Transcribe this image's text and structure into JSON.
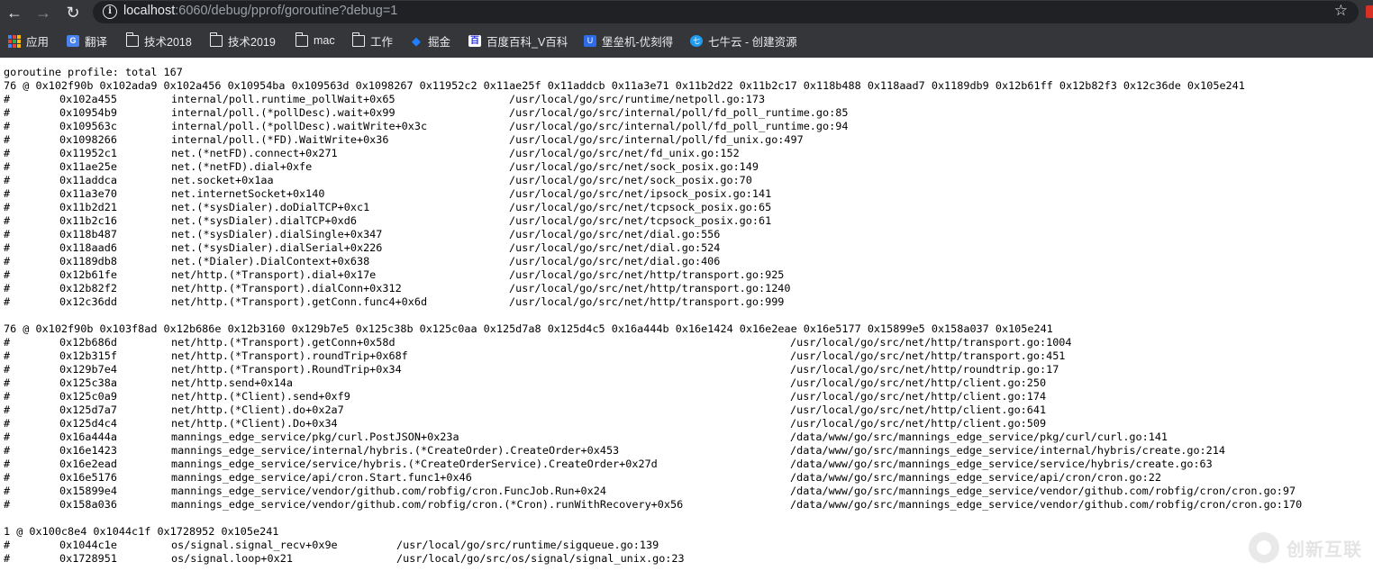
{
  "browser": {
    "url_host": "localhost",
    "url_rest": ":6060/debug/pprof/goroutine?debug=1",
    "nav_icons": [
      "back-arrow-icon",
      "forward-arrow-icon",
      "reload-icon",
      "info-icon",
      "star-icon"
    ],
    "bookmarks": [
      {
        "label": "应用",
        "icon": "apps-grid-icon"
      },
      {
        "label": "翻译",
        "icon": "google-translate-icon"
      },
      {
        "label": "技术2018",
        "icon": "folder-icon"
      },
      {
        "label": "技术2019",
        "icon": "folder-icon"
      },
      {
        "label": "mac",
        "icon": "folder-icon"
      },
      {
        "label": "工作",
        "icon": "folder-icon"
      },
      {
        "label": "掘金",
        "icon": "juejin-icon"
      },
      {
        "label": "百度百科_V百科",
        "icon": "baidu-icon"
      },
      {
        "label": "堡垒机-优刻得",
        "icon": "ucloud-icon"
      },
      {
        "label": "七牛云 - 创建资源",
        "icon": "qiniu-icon"
      }
    ]
  },
  "profile": {
    "header": "goroutine profile: total 167",
    "groups": [
      {
        "summary": "76 @ 0x102f90b 0x102ada9 0x102a456 0x10954ba 0x109563d 0x1098267 0x11952c2 0x11ae25f 0x11addcb 0x11a3e71 0x11b2d22 0x11b2c17 0x118b488 0x118aad7 0x1189db9 0x12b61ff 0x12b82f3 0x12c36de 0x105e241",
        "frames": [
          {
            "addr": "0x102a455",
            "func": "internal/poll.runtime_pollWait+0x65",
            "file": "/usr/local/go/src/runtime/netpoll.go:173"
          },
          {
            "addr": "0x10954b9",
            "func": "internal/poll.(*pollDesc).wait+0x99",
            "file": "/usr/local/go/src/internal/poll/fd_poll_runtime.go:85"
          },
          {
            "addr": "0x109563c",
            "func": "internal/poll.(*pollDesc).waitWrite+0x3c",
            "file": "/usr/local/go/src/internal/poll/fd_poll_runtime.go:94"
          },
          {
            "addr": "0x1098266",
            "func": "internal/poll.(*FD).WaitWrite+0x36",
            "file": "/usr/local/go/src/internal/poll/fd_unix.go:497"
          },
          {
            "addr": "0x11952c1",
            "func": "net.(*netFD).connect+0x271",
            "file": "/usr/local/go/src/net/fd_unix.go:152"
          },
          {
            "addr": "0x11ae25e",
            "func": "net.(*netFD).dial+0xfe",
            "file": "/usr/local/go/src/net/sock_posix.go:149"
          },
          {
            "addr": "0x11addca",
            "func": "net.socket+0x1aa",
            "file": "/usr/local/go/src/net/sock_posix.go:70"
          },
          {
            "addr": "0x11a3e70",
            "func": "net.internetSocket+0x140",
            "file": "/usr/local/go/src/net/ipsock_posix.go:141"
          },
          {
            "addr": "0x11b2d21",
            "func": "net.(*sysDialer).doDialTCP+0xc1",
            "file": "/usr/local/go/src/net/tcpsock_posix.go:65"
          },
          {
            "addr": "0x11b2c16",
            "func": "net.(*sysDialer).dialTCP+0xd6",
            "file": "/usr/local/go/src/net/tcpsock_posix.go:61"
          },
          {
            "addr": "0x118b487",
            "func": "net.(*sysDialer).dialSingle+0x347",
            "file": "/usr/local/go/src/net/dial.go:556"
          },
          {
            "addr": "0x118aad6",
            "func": "net.(*sysDialer).dialSerial+0x226",
            "file": "/usr/local/go/src/net/dial.go:524"
          },
          {
            "addr": "0x1189db8",
            "func": "net.(*Dialer).DialContext+0x638",
            "file": "/usr/local/go/src/net/dial.go:406"
          },
          {
            "addr": "0x12b61fe",
            "func": "net/http.(*Transport).dial+0x17e",
            "file": "/usr/local/go/src/net/http/transport.go:925"
          },
          {
            "addr": "0x12b82f2",
            "func": "net/http.(*Transport).dialConn+0x312",
            "file": "/usr/local/go/src/net/http/transport.go:1240"
          },
          {
            "addr": "0x12c36dd",
            "func": "net/http.(*Transport).getConn.func4+0x6d",
            "file": "/usr/local/go/src/net/http/transport.go:999"
          }
        ]
      },
      {
        "summary": "76 @ 0x102f90b 0x103f8ad 0x12b686e 0x12b3160 0x129b7e5 0x125c38b 0x125c0aa 0x125d7a8 0x125d4c5 0x16a444b 0x16e1424 0x16e2eae 0x16e5177 0x15899e5 0x158a037 0x105e241",
        "frames": [
          {
            "addr": "0x12b686d",
            "func": "net/http.(*Transport).getConn+0x58d",
            "file": "/usr/local/go/src/net/http/transport.go:1004"
          },
          {
            "addr": "0x12b315f",
            "func": "net/http.(*Transport).roundTrip+0x68f",
            "file": "/usr/local/go/src/net/http/transport.go:451"
          },
          {
            "addr": "0x129b7e4",
            "func": "net/http.(*Transport).RoundTrip+0x34",
            "file": "/usr/local/go/src/net/http/roundtrip.go:17"
          },
          {
            "addr": "0x125c38a",
            "func": "net/http.send+0x14a",
            "file": "/usr/local/go/src/net/http/client.go:250"
          },
          {
            "addr": "0x125c0a9",
            "func": "net/http.(*Client).send+0xf9",
            "file": "/usr/local/go/src/net/http/client.go:174"
          },
          {
            "addr": "0x125d7a7",
            "func": "net/http.(*Client).do+0x2a7",
            "file": "/usr/local/go/src/net/http/client.go:641"
          },
          {
            "addr": "0x125d4c4",
            "func": "net/http.(*Client).Do+0x34",
            "file": "/usr/local/go/src/net/http/client.go:509"
          },
          {
            "addr": "0x16a444a",
            "func": "mannings_edge_service/pkg/curl.PostJSON+0x23a",
            "file": "/data/www/go/src/mannings_edge_service/pkg/curl/curl.go:141"
          },
          {
            "addr": "0x16e1423",
            "func": "mannings_edge_service/internal/hybris.(*CreateOrder).CreateOrder+0x453",
            "file": "/data/www/go/src/mannings_edge_service/internal/hybris/create.go:214"
          },
          {
            "addr": "0x16e2ead",
            "func": "mannings_edge_service/service/hybris.(*CreateOrderService).CreateOrder+0x27d",
            "file": "/data/www/go/src/mannings_edge_service/service/hybris/create.go:63"
          },
          {
            "addr": "0x16e5176",
            "func": "mannings_edge_service/api/cron.Start.func1+0x46",
            "file": "/data/www/go/src/mannings_edge_service/api/cron/cron.go:22"
          },
          {
            "addr": "0x15899e4",
            "func": "mannings_edge_service/vendor/github.com/robfig/cron.FuncJob.Run+0x24",
            "file": "/data/www/go/src/mannings_edge_service/vendor/github.com/robfig/cron/cron.go:97"
          },
          {
            "addr": "0x158a036",
            "func": "mannings_edge_service/vendor/github.com/robfig/cron.(*Cron).runWithRecovery+0x56",
            "file": "/data/www/go/src/mannings_edge_service/vendor/github.com/robfig/cron/cron.go:170"
          }
        ]
      },
      {
        "summary": "1 @ 0x100c8e4 0x1044c1f 0x1728952 0x105e241",
        "frames": [
          {
            "addr": "0x1044c1e",
            "func": "os/signal.signal_recv+0x9e",
            "file": "/usr/local/go/src/runtime/sigqueue.go:139"
          },
          {
            "addr": "0x1728951",
            "func": "os/signal.loop+0x21",
            "file": "/usr/local/go/src/os/signal/signal_unix.go:23"
          }
        ]
      }
    ]
  },
  "watermark": {
    "text": "创新互联"
  }
}
